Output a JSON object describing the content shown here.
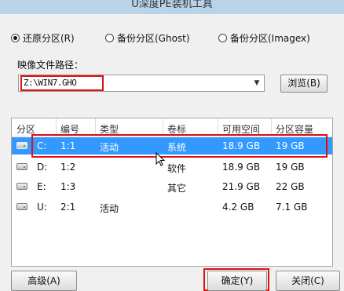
{
  "window": {
    "title": "U深度PE装机工具"
  },
  "mode_options": [
    {
      "label": "还原分区(R)",
      "selected": true
    },
    {
      "label": "备份分区(Ghost)",
      "selected": false
    },
    {
      "label": "备份分区(Imagex)",
      "selected": false
    }
  ],
  "image_path": {
    "label": "映像文件路径：",
    "value": "Z:\\WIN7.GHO",
    "browse_label": "浏览(B)"
  },
  "partition_table": {
    "columns": [
      "分区",
      "编号",
      "类型",
      "卷标",
      "可用空间",
      "分区容量"
    ],
    "rows": [
      {
        "drive": "C:",
        "number": "1:1",
        "type": "活动",
        "label": "系统",
        "free": "18.9 GB",
        "size": "19 GB",
        "selected": true
      },
      {
        "drive": "D:",
        "number": "1:2",
        "type": "",
        "label": "软件",
        "free": "18.9 GB",
        "size": "19 GB",
        "selected": false
      },
      {
        "drive": "E:",
        "number": "1:3",
        "type": "",
        "label": "其它",
        "free": "21.9 GB",
        "size": "22 GB",
        "selected": false
      },
      {
        "drive": "U:",
        "number": "2:1",
        "type": "活动",
        "label": "",
        "free": "4.2 GB",
        "size": "7.1 GB",
        "selected": false
      }
    ]
  },
  "buttons": {
    "advanced": "高级(A)",
    "ok": "确定(Y)",
    "close": "关闭(C)"
  },
  "colors": {
    "selection": "#3399ff",
    "highlight": "#e01010",
    "titlebar": "#b9d3e8"
  }
}
